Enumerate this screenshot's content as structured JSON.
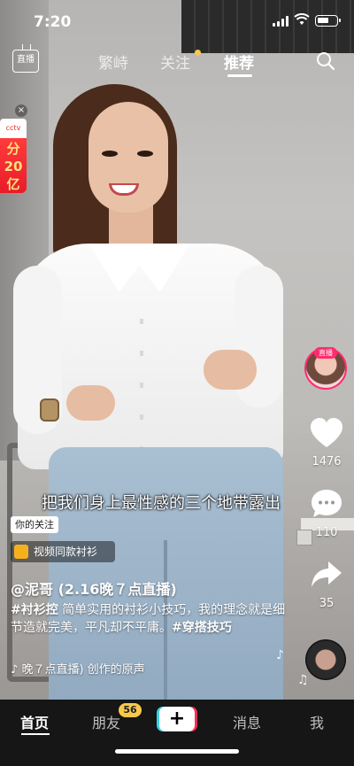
{
  "status_bar": {
    "time": "7:20"
  },
  "top_nav": {
    "live_label": "直播",
    "tabs": [
      {
        "label": "繁峙",
        "active": false
      },
      {
        "label": "关注",
        "active": false
      },
      {
        "label": "推荐",
        "active": true
      }
    ]
  },
  "promo": {
    "close": "×",
    "badge": "cctv",
    "text_top": "分",
    "text_mid": "20",
    "text_bot": "亿"
  },
  "live_tag": "直播",
  "rail": {
    "likes": "1476",
    "comments": "110",
    "shares": "35"
  },
  "subtitle": "把我们身上最性感的三个地带露出",
  "video": {
    "follow_tag": "你的关注",
    "product": "视频同款衬衫",
    "author": "@泥哥 (2.16晚７点直播)",
    "caption_tag": "#衬衫控",
    "caption_text": " 简单实用的衬衫小技巧，我的理念就是细节造就完美，平凡却不平庸。",
    "caption_tag2": "#穿搭技巧",
    "music": "晚７点直播) 创作的原声"
  },
  "tabbar": {
    "home": "首页",
    "friends": "朋友",
    "friends_badge": "56",
    "plus": "+",
    "messages": "消息",
    "me": "我"
  },
  "colors": {
    "accent": "#ff2c55",
    "badge": "#f7c94a",
    "tabbar": "#161616"
  }
}
